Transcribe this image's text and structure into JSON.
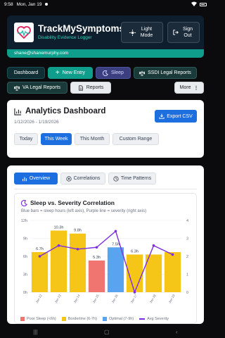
{
  "status": {
    "time": "9:58",
    "date": "Mon, Jan 19"
  },
  "header": {
    "title": "TrackMySymptoms",
    "subtitle": "Disability Evidence Logger",
    "light_mode": "Light Mode",
    "sign_out": "Sign Out",
    "email": "shane@shanemurphy.com"
  },
  "nav": {
    "dashboard": "Dashboard",
    "new_entry": "New Entry",
    "sleep": "Sleep",
    "ssdi": "SSDI Legal Reports",
    "va": "VA Legal Reports",
    "reports": "Reports",
    "more": "More"
  },
  "analytics": {
    "title": "Analytics Dashboard",
    "date_range": "1/12/2026 - 1/19/2026",
    "export": "Export CSV",
    "ranges": [
      "Today",
      "This Week",
      "This Month",
      "Custom Range"
    ],
    "active_range": "This Week"
  },
  "tabs": {
    "overview": "Overview",
    "correlations": "Correlations",
    "time_patterns": "Time Patterns"
  },
  "chart_data": {
    "type": "bar",
    "title": "Sleep vs. Severity Correlation",
    "subtitle": "Blue bars = sleep hours (left axis), Purple line = severity (right axis)",
    "categories": [
      "Jan 12",
      "Jan 13",
      "Jan 14",
      "Jan 15",
      "Jan 16",
      "Jan 17",
      "Jan 18",
      "Jan 19"
    ],
    "bar_labels": [
      "6.7h",
      "10.3h",
      "9.8h",
      "5.3h",
      "7.5h",
      "6.3h",
      "",
      ""
    ],
    "series": [
      {
        "name": "Sleep hours",
        "axis": "left",
        "values": [
          6.7,
          10.3,
          9.8,
          5.3,
          7.5,
          6.3,
          6.3,
          6.7
        ]
      },
      {
        "name": "Avg Severity",
        "axis": "right",
        "values": [
          2.0,
          2.6,
          2.4,
          2.5,
          3.4,
          0.0,
          2.6,
          2.1
        ]
      }
    ],
    "bar_colors": [
      "#f5c518",
      "#f5c518",
      "#f5c518",
      "#f07470",
      "#5aa3f0",
      "#f5c518",
      "#f5c518",
      "#f5c518"
    ],
    "left_ticks": [
      "0h",
      "3h",
      "6h",
      "9h",
      "12h"
    ],
    "right_ticks": [
      "0",
      "1",
      "2",
      "3",
      "4"
    ],
    "ylim_left": [
      0,
      12
    ],
    "ylim_right": [
      0,
      4
    ],
    "legend": [
      "Poor Sleep (<6h)",
      "Borderline (6-7h)",
      "Optimal (7-9h)",
      "Avg Severity"
    ],
    "legend_colors": [
      "#f07470",
      "#f5c518",
      "#5aa3f0",
      "#7b2ee0"
    ],
    "line_color": "#7b2ee0",
    "grid": true
  }
}
